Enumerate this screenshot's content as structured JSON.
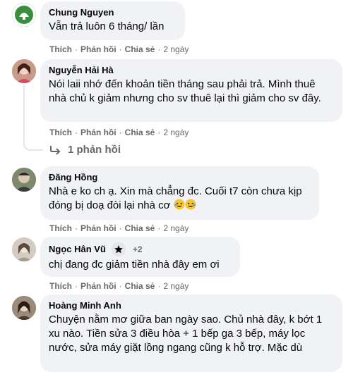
{
  "actions": {
    "like": "Thích",
    "reply": "Phản hồi",
    "share": "Chia sẻ",
    "separator": "·"
  },
  "comments": [
    {
      "author": "Chung Nguyen",
      "text": "Vẫn trả luôn 6 tháng/ lần",
      "time": "2 ngày"
    },
    {
      "author": "Nguyễn Hải Hà",
      "text": "Nói laii nhớ đến khoản tiền tháng sau phải trả. Mình thuê nhà chủ k giảm nhưng cho sv thuê lại thì giảm cho sv đây.",
      "time": "2 ngày",
      "replies_label": "1 phản hồi"
    },
    {
      "author": "Đăng Hồng",
      "text": "Nhà e ko ch ạ. Xin mà chẳng đc. Cuối t7 còn chưa kịp đóng bị doạ đòi lại nhà cơ",
      "time": "2 ngày"
    },
    {
      "author": "Ngọc Hân Vũ",
      "badge_extra": "+2",
      "text": "chị đang đc giảm tiền nhà đây em ơi",
      "time": "2 ngày"
    },
    {
      "author": "Hoàng Minh Anh",
      "text": "Chuyện nằm mơ giữa ban ngày sao. Chủ nhà đây, k bớt 1 xu nào. Tiền sửa 3 điều hòa + 1 bếp ga 3 bếp, máy lọc nước, sửa máy giặt lồng ngang cũng k hỗ trợ. Mặc dù"
    }
  ],
  "colors": {
    "bubble": "#f0f2f5",
    "meta": "#65676b",
    "text": "#050505"
  }
}
